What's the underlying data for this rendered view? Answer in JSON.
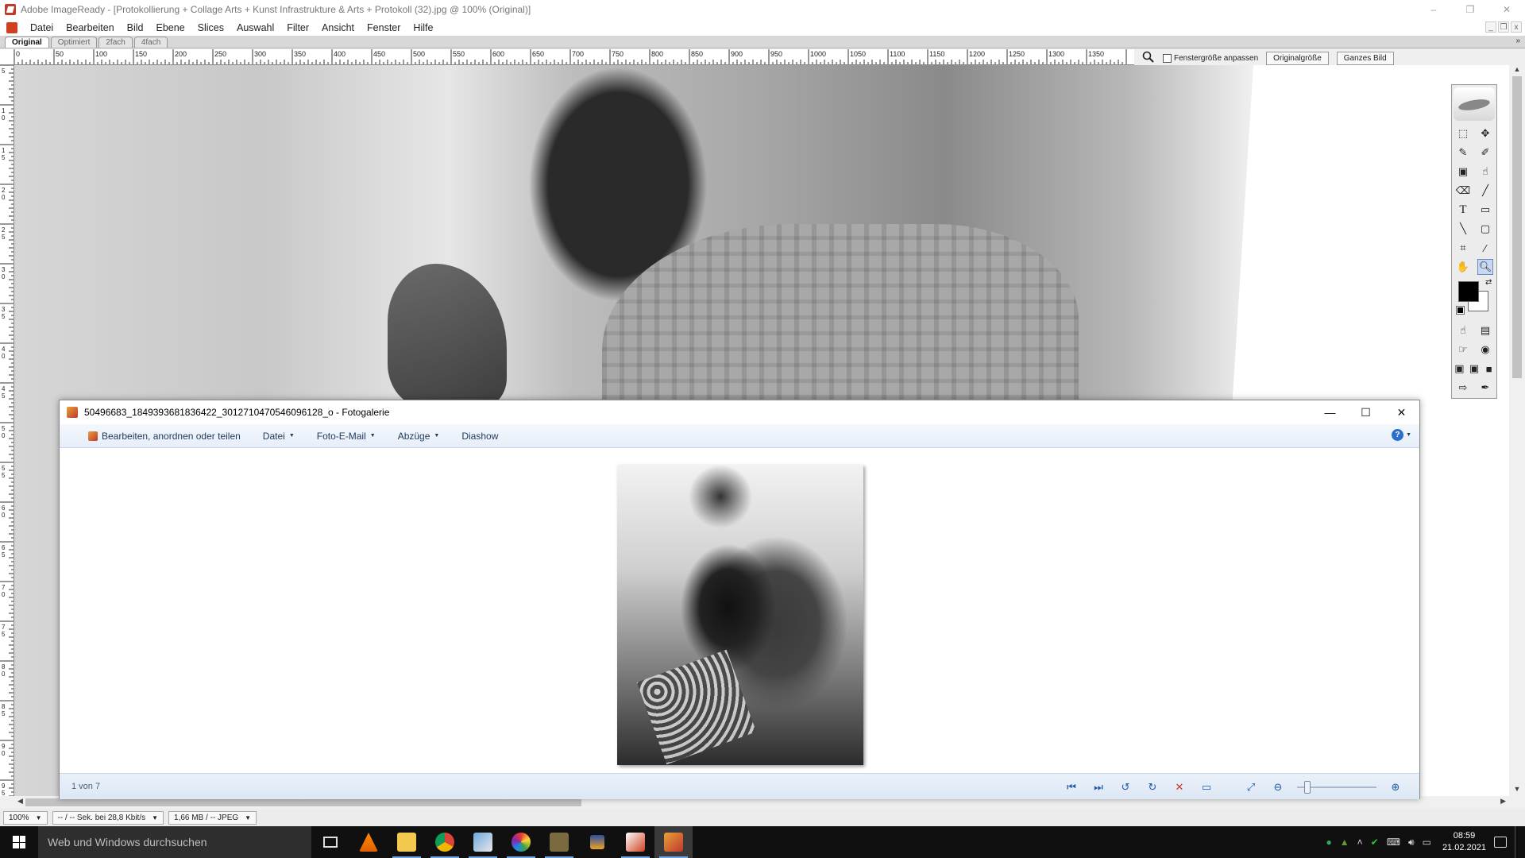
{
  "imageready": {
    "title": "Adobe ImageReady - [Protokollierung + Collage Arts + Kunst Infrastrukture & Arts + Protokoll (32).jpg @ 100% (Original)]",
    "window_controls": {
      "minimize": "–",
      "restore": "❐",
      "close": "✕"
    },
    "menu": [
      "Datei",
      "Bearbeiten",
      "Bild",
      "Ebene",
      "Slices",
      "Auswahl",
      "Filter",
      "Ansicht",
      "Fenster",
      "Hilfe"
    ],
    "mdi_controls": {
      "minimize": "_",
      "restore": "❐",
      "close": "x"
    },
    "view_tabs": [
      "Original",
      "Optimiert",
      "2fach",
      "4fach"
    ],
    "tabs_more": "»",
    "ruler_labels": [
      "0",
      "50",
      "100",
      "150",
      "200",
      "250",
      "300",
      "350",
      "400",
      "450",
      "500",
      "550",
      "600",
      "650",
      "700",
      "750",
      "800",
      "850",
      "900",
      "950",
      "1000",
      "1050",
      "1100",
      "1150",
      "1200",
      "1250",
      "1300",
      "1350"
    ],
    "vruler_labels": [
      "5",
      "10",
      "15",
      "20",
      "25",
      "30",
      "35",
      "40",
      "45",
      "50",
      "55",
      "60",
      "65",
      "70",
      "75",
      "80",
      "85",
      "90",
      "95",
      "100"
    ],
    "zoombar": {
      "fit_label": "Fenstergröße anpassen",
      "fit_checked": false,
      "original_size": "Originalgröße",
      "whole_image": "Ganzes Bild"
    },
    "status": {
      "zoom": "100%",
      "speed": "-- / -- Sek. bei 28,8 Kbit/s",
      "filesize": "1,66 MB / -- JPEG"
    },
    "toolbox": {
      "tools": [
        [
          "marquee-tool",
          "move-tool"
        ],
        [
          "slice-tool",
          "slice-select-tool"
        ],
        [
          "imagemap-tool",
          "imagemap-select-tool"
        ],
        [
          "eraser-tool",
          "brush-tool"
        ],
        [
          "type-tool",
          "shape-tool"
        ],
        [
          "line-tool",
          "rounded-rect-tool"
        ],
        [
          "crop-tool",
          "eyedropper-tool"
        ],
        [
          "hand-tool",
          "zoom-tool"
        ]
      ],
      "foreground_color": "#000000",
      "background_color": "#ffffff"
    }
  },
  "gallery": {
    "title": "50496683_1849393681836422_3012710470546096128_o - Fotogalerie",
    "window_controls": {
      "minimize": "—",
      "maximize": "☐",
      "close": "✕"
    },
    "commands": [
      {
        "label": "Bearbeiten, anordnen oder teilen",
        "dropdown": false
      },
      {
        "label": "Datei",
        "dropdown": true
      },
      {
        "label": "Foto-E-Mail",
        "dropdown": true
      },
      {
        "label": "Abzüge",
        "dropdown": true
      },
      {
        "label": "Diashow",
        "dropdown": false
      }
    ],
    "help": "?",
    "counter": "1 von 7",
    "zoom_fraction": 0.1
  },
  "taskbar": {
    "search_placeholder": "Web und Windows durchsuchen",
    "apps": [
      "task-view",
      "vlc",
      "file-explorer",
      "chrome",
      "photo-viewer",
      "picasa",
      "photo-tool",
      "pin",
      "imageready",
      "fotogalerie"
    ],
    "time": "08:59",
    "date": "21.02.2021"
  }
}
